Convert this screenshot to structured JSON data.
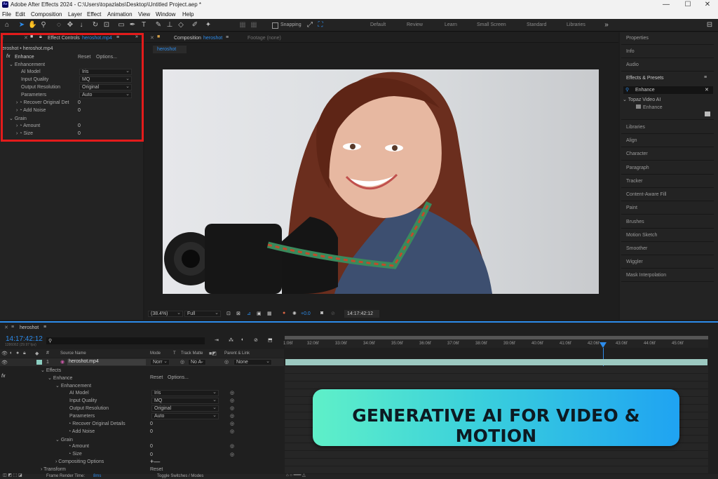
{
  "titlebar": {
    "title": "Adobe After Effects 2024 - C:\\Users\\topazlabs\\Desktop\\Untitled Project.aep *",
    "app_icon": "Ae",
    "minimize": "—",
    "maximize": "☐",
    "close": "✕"
  },
  "menu": [
    "File",
    "Edit",
    "Composition",
    "Layer",
    "Effect",
    "Animation",
    "View",
    "Window",
    "Help"
  ],
  "toolbar": {
    "snapping": "Snapping",
    "workspaces": [
      "Default",
      "Review",
      "Learn",
      "Small Screen",
      "Standard",
      "Libraries"
    ]
  },
  "effect_controls": {
    "tab_label": "Effect Controls",
    "tab_file": "heroshot.mp4",
    "breadcrumb": "eroshot • heroshot.mp4",
    "effect": {
      "fx": "fx",
      "name": "Enhance",
      "reset": "Reset",
      "options": "Options..."
    },
    "groups": {
      "enhancement": "Enhancement",
      "grain": "Grain"
    },
    "props": [
      {
        "label": "AI Model",
        "value": "Iris"
      },
      {
        "label": "Input Quality",
        "value": "MQ"
      },
      {
        "label": "Output Resolution",
        "value": "Original"
      },
      {
        "label": "Parameters",
        "value": "Auto"
      }
    ],
    "sliders": [
      {
        "label": "Recover Original Det",
        "value": "0"
      },
      {
        "label": "Add Noise",
        "value": "0"
      }
    ],
    "grain": [
      {
        "label": "Amount",
        "value": "0"
      },
      {
        "label": "Size",
        "value": "0"
      }
    ]
  },
  "composition": {
    "tab_label": "Composition",
    "tab_name": "heroshot",
    "footage": "Footage (none)",
    "subtab": "heroshot",
    "zoom": "(38.4%)",
    "quality": "Full",
    "exposure": "+0.0",
    "timecode": "14:17:42:12"
  },
  "right_panel": {
    "items_top": [
      "Properties",
      "Info",
      "Audio"
    ],
    "effects_presets": "Effects & Presets",
    "search": "Enhance",
    "tree_group": "Topaz Video AI",
    "tree_item": "Enhance",
    "items_bottom": [
      "Libraries",
      "Align",
      "Character",
      "Paragraph",
      "Tracker",
      "Content-Aware Fill",
      "Paint",
      "Brushes",
      "Motion Sketch",
      "Smoother",
      "Wiggler",
      "Mask Interpolation"
    ]
  },
  "timeline": {
    "tab": "heroshot",
    "timecode": "14:17:42:12",
    "frames": "1286062 (29.97 fps)",
    "search_placeholder": "",
    "headers": {
      "source": "Source Name",
      "mode": "Mode",
      "t": "T",
      "matte": "Track Matte",
      "parent": "Parent & Link"
    },
    "ruler": [
      "1:06f",
      "32:06f",
      "33:06f",
      "34:06f",
      "35:06f",
      "36:06f",
      "37:06f",
      "38:06f",
      "39:06f",
      "40:06f",
      "41:06f",
      "42:06f",
      "43:06f",
      "44:06f",
      "45:06f"
    ],
    "layer": {
      "num": "1",
      "name": "heroshot.mp4",
      "mode": "Norr",
      "matte": "No A",
      "parent": "None"
    },
    "effects": "Effects",
    "enhance": "Enhance",
    "reset": "Reset",
    "options": "Options...",
    "enhancement": "Enhancement",
    "props": [
      {
        "label": "AI Model",
        "value": "Iris"
      },
      {
        "label": "Input Quality",
        "value": "MQ"
      },
      {
        "label": "Output Resolution",
        "value": "Original"
      },
      {
        "label": "Parameters",
        "value": "Auto"
      }
    ],
    "sliders": [
      {
        "label": "Recover Original Details",
        "value": "0"
      },
      {
        "label": "Add Noise",
        "value": "0"
      }
    ],
    "grain": "Grain",
    "grain_props": [
      {
        "label": "Amount",
        "value": "0"
      },
      {
        "label": "Size",
        "value": "0"
      }
    ],
    "compositing": "Compositing Options",
    "compositing_ctrl": "+—",
    "transform": "Transform",
    "transform_reset": "Reset",
    "footer": {
      "render": "Frame Render Time:",
      "render_val": "8ms",
      "toggle": "Toggle Switches / Modes"
    }
  },
  "banner": {
    "text": "GENERATIVE AI FOR VIDEO & MOTION"
  },
  "colors": {
    "accent": "#2d8ceb",
    "highlight_box": "#e31b1b",
    "banner_start": "#5ff0c8",
    "banner_end": "#1fa3f2",
    "track": "#9cc9c1"
  }
}
